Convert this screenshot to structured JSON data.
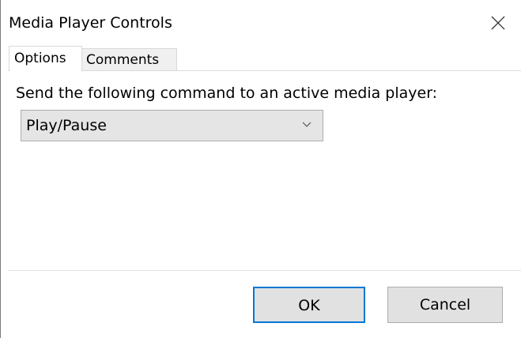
{
  "window": {
    "title": "Media Player Controls"
  },
  "tabs": [
    {
      "label": "Options",
      "active": true
    },
    {
      "label": "Comments",
      "active": false
    }
  ],
  "options_panel": {
    "instruction": "Send the following command to an active media player:",
    "command_select": {
      "value": "Play/Pause"
    }
  },
  "buttons": {
    "ok": "OK",
    "cancel": "Cancel"
  },
  "icons": {
    "close": "close-icon",
    "dropdown": "chevron-down-icon"
  },
  "colors": {
    "accent": "#0078d7",
    "button_face": "#e1e1e1",
    "combo_face": "#e5e5e5",
    "inactive_tab": "#f0f0f0"
  }
}
